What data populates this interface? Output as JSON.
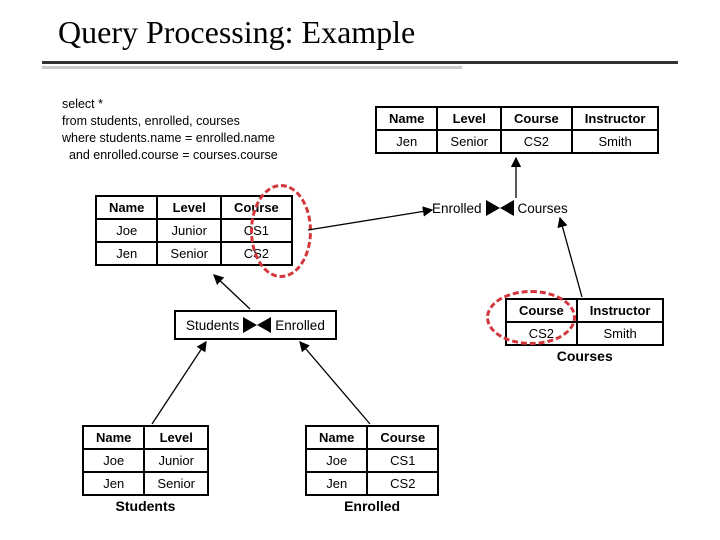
{
  "title": "Query Processing: Example",
  "query": "select *\nfrom students, enrolled, courses\nwhere students.name = enrolled.name\n  and enrolled.course = courses.course",
  "result_table": {
    "headers": [
      "Name",
      "Level",
      "Course",
      "Instructor"
    ],
    "rows": [
      [
        "Jen",
        "Senior",
        "CS2",
        "Smith"
      ]
    ]
  },
  "se_joined": {
    "headers": [
      "Name",
      "Level",
      "Course"
    ],
    "rows": [
      [
        "Joe",
        "Junior",
        "CS1"
      ],
      [
        "Jen",
        "Senior",
        "CS2"
      ]
    ]
  },
  "join1": {
    "left": "Students",
    "right": "Enrolled"
  },
  "join2": {
    "left": "Enrolled",
    "right": "Courses"
  },
  "students": {
    "headers": [
      "Name",
      "Level"
    ],
    "rows": [
      [
        "Joe",
        "Junior"
      ],
      [
        "Jen",
        "Senior"
      ]
    ],
    "caption": "Students"
  },
  "enrolled": {
    "headers": [
      "Name",
      "Course"
    ],
    "rows": [
      [
        "Joe",
        "CS1"
      ],
      [
        "Jen",
        "CS2"
      ]
    ],
    "caption": "Enrolled"
  },
  "courses": {
    "headers": [
      "Course",
      "Instructor"
    ],
    "rows": [
      [
        "CS2",
        "Smith"
      ]
    ],
    "caption": "Courses"
  }
}
